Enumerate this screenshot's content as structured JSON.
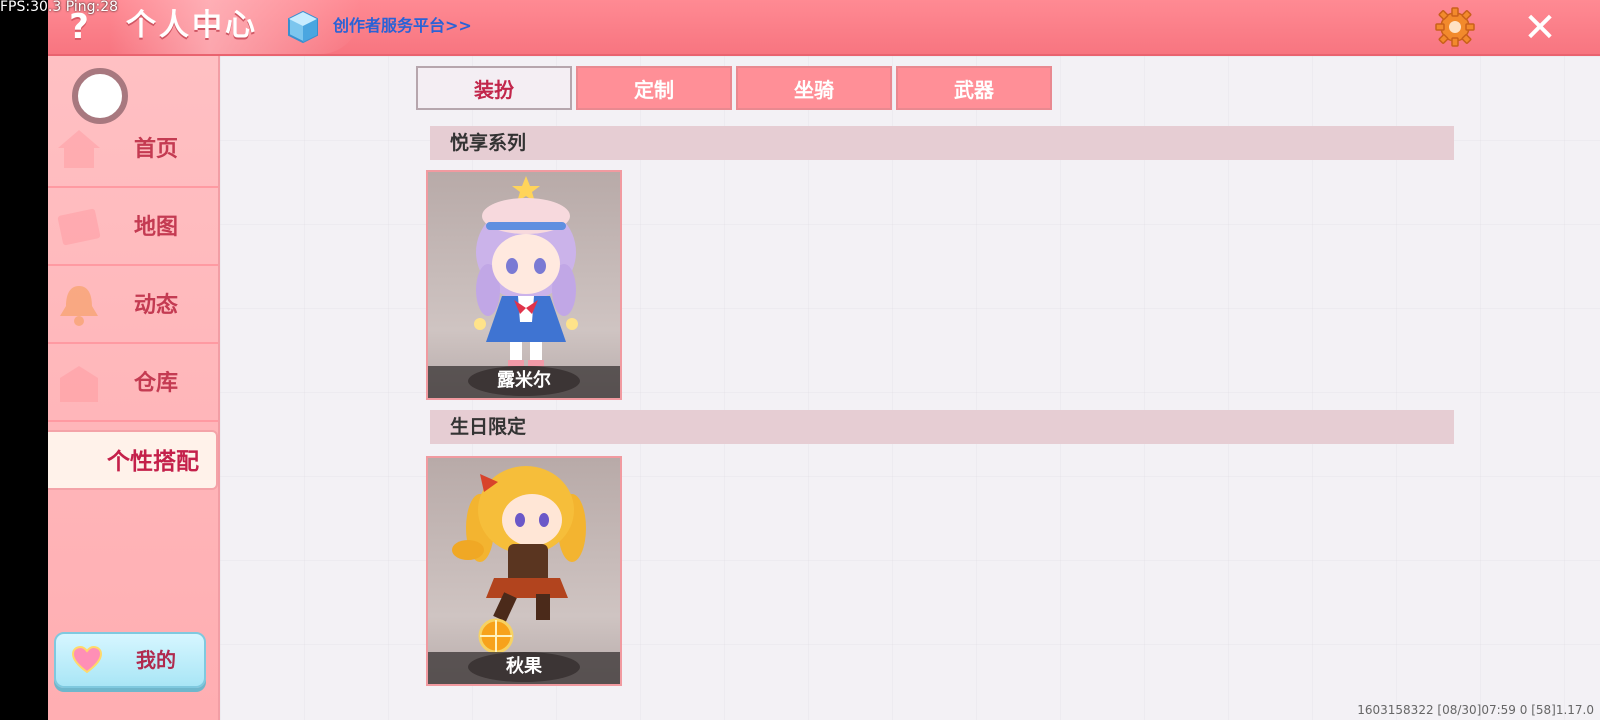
{
  "overlay": {
    "fps_text": "FPS:30.3  Ping:28"
  },
  "header": {
    "help_icon": "?",
    "title": "个人中心",
    "creator_link": "创作者服务平台>>",
    "close_icon": "✕"
  },
  "sidebar": {
    "items": [
      {
        "label": "首页",
        "icon": "home-icon"
      },
      {
        "label": "地图",
        "icon": "map-icon"
      },
      {
        "label": "动态",
        "icon": "bell-icon"
      },
      {
        "label": "仓库",
        "icon": "warehouse-icon"
      },
      {
        "label": "个性搭配",
        "icon": "outfit-icon",
        "active": true
      }
    ],
    "mine_label": "我的"
  },
  "tabs": [
    {
      "label": "装扮",
      "active": true
    },
    {
      "label": "定制",
      "active": false
    },
    {
      "label": "坐骑",
      "active": false
    },
    {
      "label": "武器",
      "active": false
    }
  ],
  "sections": [
    {
      "title": "悦享系列",
      "items": [
        {
          "name": "露米尔"
        }
      ]
    },
    {
      "title": "生日限定",
      "items": [
        {
          "name": "秋果"
        }
      ]
    }
  ],
  "footer": {
    "info": "1603158322   [08/30]07:59 0   [58]1.17.0"
  },
  "colors": {
    "topbar": "#f77580",
    "sidebar": "#ffb1b5",
    "accent": "#c2264b",
    "link": "#2a62d6"
  }
}
